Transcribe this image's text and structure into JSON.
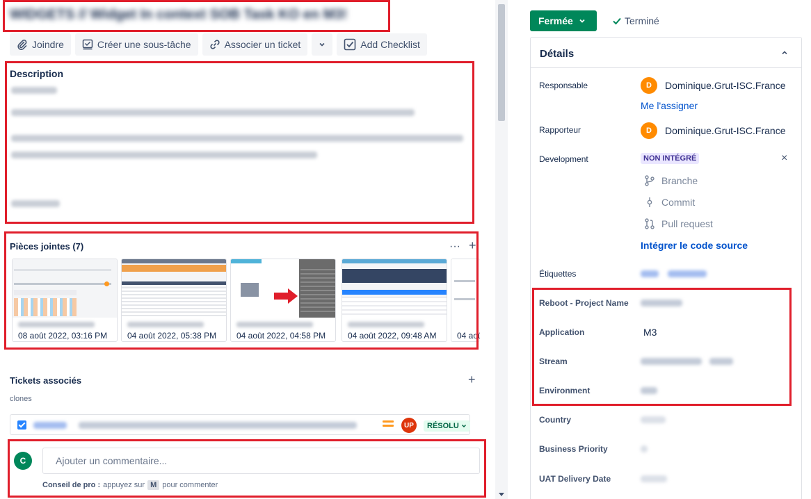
{
  "issue": {
    "title": "WIDGETS // Widget In context SOB Task KO en M3!"
  },
  "toolbar": {
    "attach": "Joindre",
    "create_subtask": "Créer une sous-tâche",
    "link_ticket": "Associer un ticket",
    "add_checklist": "Add Checklist"
  },
  "description": {
    "label": "Description"
  },
  "attachments": {
    "label": "Pièces jointes (7)",
    "more": "···",
    "add": "+",
    "items": [
      {
        "date": "08 août 2022, 03:16 PM"
      },
      {
        "date": "04 août 2022, 05:38 PM"
      },
      {
        "date": "04 août 2022, 04:58 PM"
      },
      {
        "date": "04 août 2022, 09:48 AM"
      },
      {
        "date": "04 aoû"
      }
    ]
  },
  "linked": {
    "label": "Tickets associés",
    "add": "+",
    "relation": "clones",
    "ticket": {
      "avatar": "UP",
      "status": "RÉSOLU"
    }
  },
  "comment": {
    "avatar": "C",
    "placeholder": "Ajouter un commentaire...",
    "tip_prefix": "Conseil de pro :",
    "tip_text": "appuyez sur",
    "tip_key": "M",
    "tip_suffix": "pour commenter"
  },
  "status": {
    "button": "Fermée",
    "resolution": "Terminé"
  },
  "details": {
    "title": "Détails",
    "assignee_label": "Responsable",
    "assignee_avatar": "D",
    "assignee": "Dominique.Grut-ISC.France",
    "assign_me": "Me l'assigner",
    "reporter_label": "Rapporteur",
    "reporter_avatar": "D",
    "reporter": "Dominique.Grut-ISC.France",
    "development_label": "Development",
    "dev_badge": "NON INTÉGRÉ",
    "dev_close": "×",
    "branch": "Branche",
    "commit": "Commit",
    "pull_request": "Pull request",
    "integrate": "Intégrer le code source",
    "labels_label": "Étiquettes",
    "project_name_label": "Reboot - Project Name",
    "application_label": "Application",
    "application": "M3",
    "stream_label": "Stream",
    "environment_label": "Environment",
    "country_label": "Country",
    "business_priority_label": "Business Priority",
    "uat_label": "UAT Delivery Date"
  },
  "colors": {
    "highlight": "#e01e2b",
    "status_green": "#00875a",
    "link_blue": "#0052cc"
  }
}
